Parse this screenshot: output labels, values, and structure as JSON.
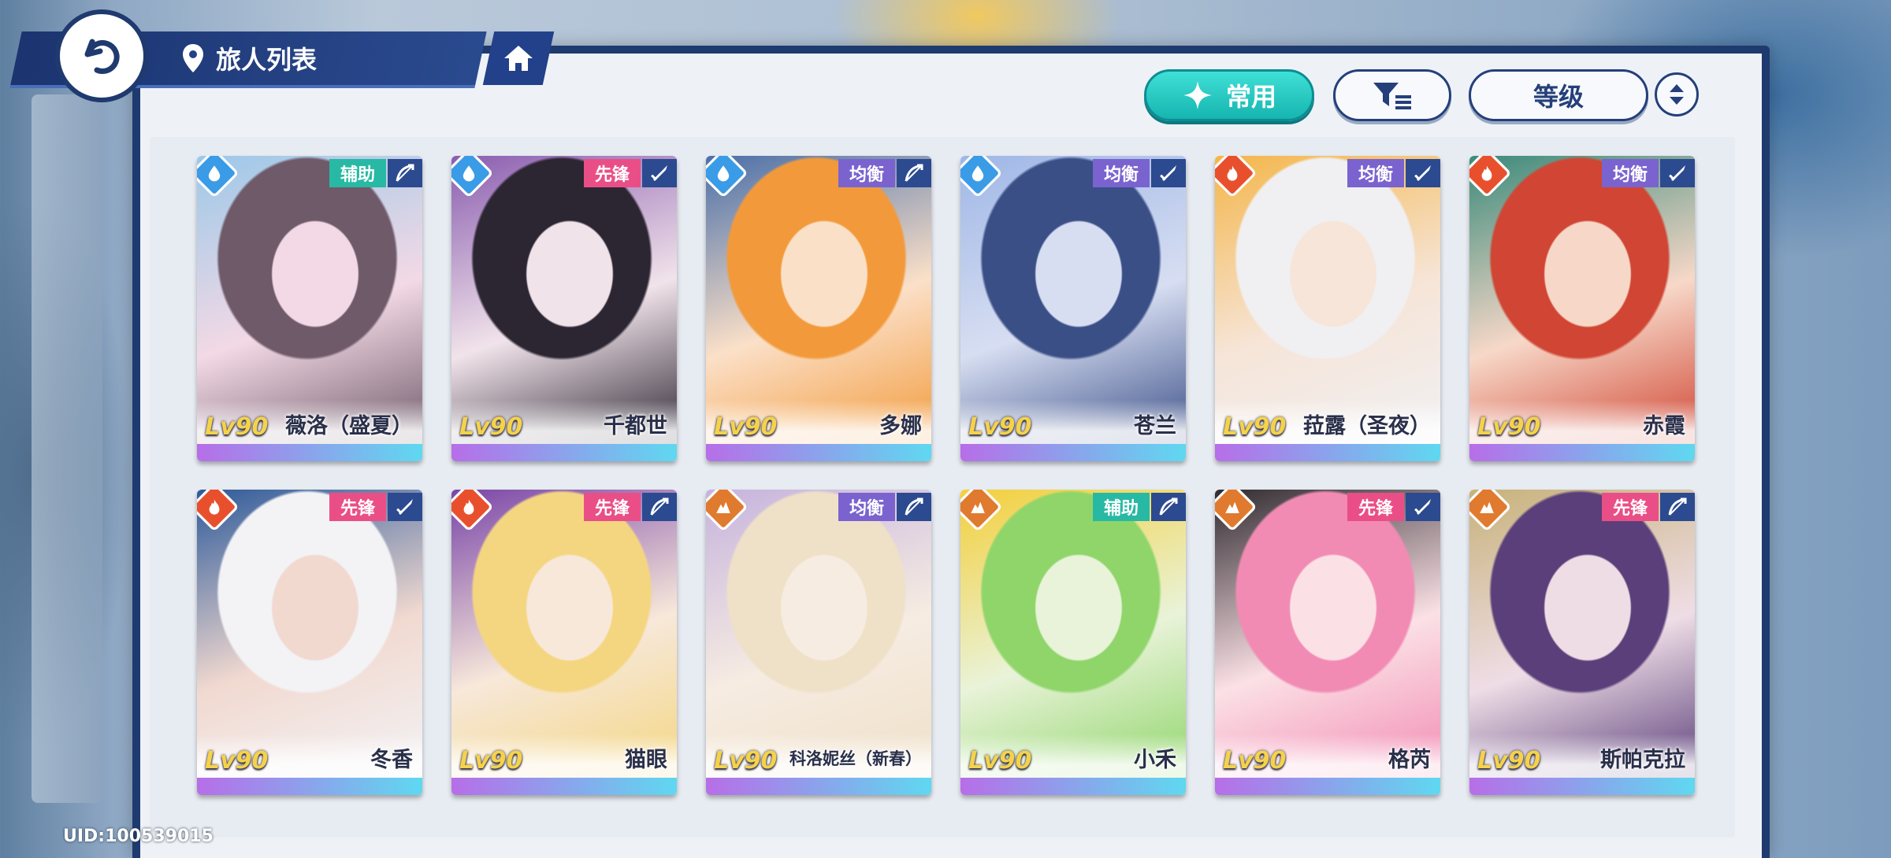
{
  "header": {
    "title": "旅人列表"
  },
  "toolbar": {
    "common_label": "常用",
    "sort_label": "等级"
  },
  "colors": {
    "support": "#27b9a3",
    "vanguard": "#e94f86",
    "balanced": "#7a63cf",
    "water": "#3a9be6",
    "fire": "#e8502d",
    "earth": "#e07a2e"
  },
  "characters": [
    {
      "level": "Lv90",
      "name": "薇洛（盛夏）",
      "role": "辅助",
      "role_type": "support",
      "element": "water",
      "weapon": "bow"
    },
    {
      "level": "Lv90",
      "name": "千都世",
      "role": "先锋",
      "role_type": "vanguard",
      "element": "water",
      "weapon": "sword"
    },
    {
      "level": "Lv90",
      "name": "多娜",
      "role": "均衡",
      "role_type": "balanced",
      "element": "water",
      "weapon": "bow"
    },
    {
      "level": "Lv90",
      "name": "苍兰",
      "role": "均衡",
      "role_type": "balanced",
      "element": "water",
      "weapon": "sword"
    },
    {
      "level": "Lv90",
      "name": "菈露（圣夜）",
      "role": "均衡",
      "role_type": "balanced",
      "element": "fire",
      "weapon": "sword"
    },
    {
      "level": "Lv90",
      "name": "赤霞",
      "role": "均衡",
      "role_type": "balanced",
      "element": "fire",
      "weapon": "sword"
    },
    {
      "level": "Lv90",
      "name": "冬香",
      "role": "先锋",
      "role_type": "vanguard",
      "element": "fire",
      "weapon": "sword"
    },
    {
      "level": "Lv90",
      "name": "猫眼",
      "role": "先锋",
      "role_type": "vanguard",
      "element": "fire",
      "weapon": "bow"
    },
    {
      "level": "Lv90",
      "name": "科洛妮丝（新春）",
      "role": "均衡",
      "role_type": "balanced",
      "element": "earth",
      "weapon": "bow"
    },
    {
      "level": "Lv90",
      "name": "小禾",
      "role": "辅助",
      "role_type": "support",
      "element": "earth",
      "weapon": "bow"
    },
    {
      "level": "Lv90",
      "name": "格芮",
      "role": "先锋",
      "role_type": "vanguard",
      "element": "earth",
      "weapon": "sword"
    },
    {
      "level": "Lv90",
      "name": "斯帕克拉",
      "role": "先锋",
      "role_type": "vanguard",
      "element": "earth",
      "weapon": "bow"
    }
  ],
  "footer": {
    "uid": "UID:100539015"
  }
}
